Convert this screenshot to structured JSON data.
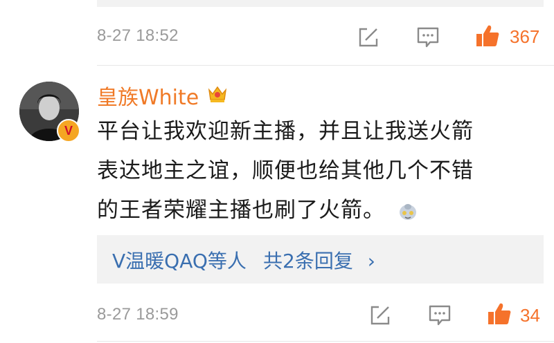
{
  "previous_comment": {
    "timestamp": "8-27 18:52",
    "like_count": "367"
  },
  "comment": {
    "username": "皇族White",
    "verified_badge": "V",
    "text_lines": [
      "平台让我欢迎新主播，并且让我送火箭",
      "表达地主之谊，顺便也给其他几个不错",
      "的王者荣耀主播也刷了火箭。"
    ],
    "replies": {
      "users_label": "V温暖QAQ等人",
      "count_label": "共2条回复",
      "arrow": "›"
    },
    "timestamp": "8-27 18:59",
    "like_count": "34"
  },
  "colors": {
    "accent_orange": "#f07a27",
    "link_blue": "#3a6fb0",
    "meta_gray": "#9a9a9a",
    "reply_bg": "#f2f2f2"
  },
  "icons": [
    "edit-icon",
    "comment-icon",
    "thumbs-up-icon",
    "crown-icon",
    "emoji-icon"
  ]
}
